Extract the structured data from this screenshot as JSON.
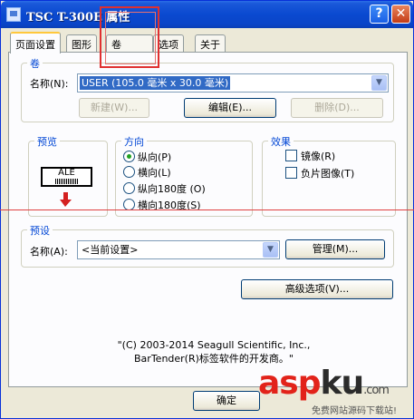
{
  "window": {
    "title": "TSC  T-300E 属性",
    "help_glyph": "?",
    "close_glyph": "✕"
  },
  "tabs": [
    "页面设置",
    "图形",
    "卷",
    "选项",
    "关于"
  ],
  "roll_group": {
    "label": "卷",
    "name_label": "名称(N):",
    "name_value": "USER (105.0 毫米 x 30.0 毫米)",
    "new_button": "新建(W)...",
    "edit_button": "编辑(E)...",
    "delete_button": "删除(D)..."
  },
  "preview_group": {
    "label": "预览",
    "sample_text": "ALE"
  },
  "orientation_group": {
    "label": "方向",
    "options": [
      "纵向(P)",
      "横向(L)",
      "纵向180度 (O)",
      "横向180度(S)"
    ],
    "selected_index": 0
  },
  "effects_group": {
    "label": "效果",
    "options": [
      "镜像(R)",
      "负片图像(T)"
    ]
  },
  "preset_group": {
    "label": "预设",
    "name_label": "名称(A):",
    "name_value": "<当前设置>",
    "manage_button": "管理(M)..."
  },
  "advanced_button": "高级选项(V)...",
  "footer": {
    "line1": "\"(C) 2003-2014 Seagull Scientific, Inc.,",
    "line2": "BarTender(R)标签软件的开发商。\""
  },
  "ok_button": "确定",
  "watermark": {
    "brand_red": "asp",
    "brand_dark": "ku",
    "domain": ".com",
    "tagline": "免费网站源码下载站!"
  },
  "colors": {
    "titlebar": "#0a49d0",
    "group_label": "#0046d5",
    "selection": "#316ac5",
    "annotation_red": "#e03030"
  }
}
